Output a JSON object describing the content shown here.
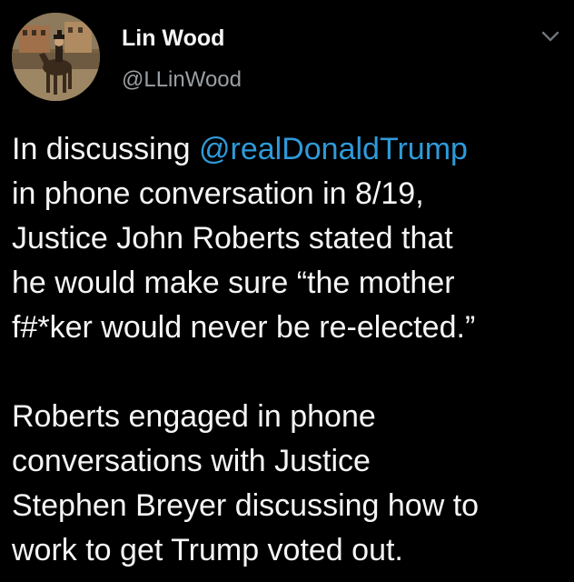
{
  "tweet": {
    "author": {
      "display_name": "Lin Wood",
      "handle": "@LLinWood",
      "avatar_icon": "avatar-horse-rider"
    },
    "menu_icon": "chevron-down-icon",
    "colors": {
      "background": "#000000",
      "text": "#f5f5f5",
      "handle": "#9a9fa4",
      "mention": "#2f9ad8"
    },
    "body": {
      "paragraph1": {
        "line1_prefix": "In discussing ",
        "mention": "@realDonaldTrump",
        "line2": "in phone conversation in 8/19,",
        "line3": "Justice John Roberts stated that",
        "line4": "he would make sure “the mother",
        "line5": "f#*ker would never be re-elected.”"
      },
      "paragraph2": {
        "line1": "Roberts engaged in phone",
        "line2": "conversations with Justice",
        "line3": "Stephen Breyer discussing how to",
        "line4": "work to get Trump voted out."
      }
    }
  }
}
